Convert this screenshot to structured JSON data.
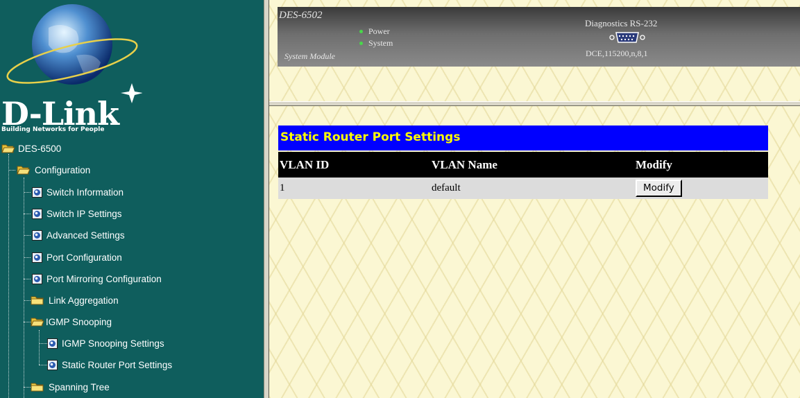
{
  "nav": {
    "logo_text": "D-Link",
    "logo_tagline": "Building Networks for People",
    "root": "DES-6500",
    "configuration": "Configuration",
    "items": [
      "Switch Information",
      "Switch IP Settings",
      "Advanced Settings",
      "Port Configuration",
      "Port Mirroring Configuration",
      "Link Aggregation",
      "IGMP Snooping",
      "IGMP Snooping Settings",
      "Static Router Port Settings",
      "Spanning Tree"
    ]
  },
  "device": {
    "model": "DES-6502",
    "module": "System Module",
    "led_power": "Power",
    "led_system": "System",
    "diag_title": "Diagnostics RS-232",
    "diag_settings": "DCE,115200,n,8,1"
  },
  "content": {
    "title": "Static Router Port Settings",
    "columns": [
      "VLAN ID",
      "VLAN Name",
      "Modify"
    ],
    "rows": [
      {
        "vlan_id": "1",
        "vlan_name": "default",
        "modify_label": "Modify"
      }
    ]
  },
  "colors": {
    "nav_bg": "#0f5e5d",
    "banner_bg": "#0000ff",
    "banner_text": "#ffff00",
    "header_bg": "#000000",
    "row_bg": "#dcdcdc",
    "page_bg": "#fbf7d3"
  }
}
